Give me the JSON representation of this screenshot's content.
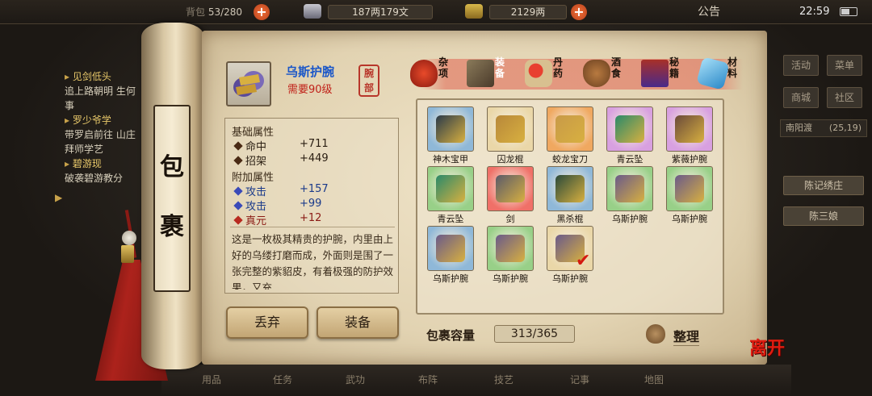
{
  "topbar": {
    "capacity": "53/280",
    "silver": "187两179文",
    "gold": "2129两",
    "notice": "公告",
    "clock": "22:59"
  },
  "quests": [
    {
      "title": "见剑低头",
      "desc": "追上路朝明 生何事"
    },
    {
      "title": "罗少爷学",
      "desc": "带罗启前往 山庄拜师学艺"
    },
    {
      "title": "碧游现",
      "desc": "破袭碧游教分"
    }
  ],
  "side_menu": {
    "buttons": [
      "活动",
      "菜单",
      "商城",
      "社区"
    ],
    "location": "南阳渡",
    "coords": "(25,19)",
    "npcs": [
      "陈记绣庄",
      "陈三娘"
    ]
  },
  "scroll_title": [
    "包",
    "裹"
  ],
  "item": {
    "name": "乌斯护腕",
    "level": "需要90级",
    "slot": "腕部",
    "base_header": "基础属性",
    "base_stats": [
      {
        "label": "命中",
        "value": "+711"
      },
      {
        "label": "招架",
        "value": "+449"
      }
    ],
    "extra_header": "附加属性",
    "extra_stats": [
      {
        "label": "攻击",
        "value": "+157"
      },
      {
        "label": "攻击",
        "value": "+99"
      },
      {
        "label": "真元",
        "value": "+12"
      }
    ],
    "description": "这是一枚极其精贵的护腕，内里由上好的乌缕打磨而成，外面则是围了一张完整的紫貂皮，有着极强的防护效果，又充"
  },
  "categories": [
    {
      "label": "杂项",
      "icon": "jar-icon"
    },
    {
      "label": "装备",
      "icon": "equipment-icon"
    },
    {
      "label": "丹药",
      "icon": "pill-icon"
    },
    {
      "label": "酒食",
      "icon": "wine-icon"
    },
    {
      "label": "秘籍",
      "icon": "book-icon"
    },
    {
      "label": "材料",
      "icon": "crystal-icon"
    }
  ],
  "grid_items": [
    {
      "name": "神木宝甲",
      "bg": "#8fb8d8",
      "gem": "#2a3a4a"
    },
    {
      "name": "囚龙棍",
      "bg": "#ead7a8",
      "gem": "#b8883a"
    },
    {
      "name": "蛟龙宝刀",
      "bg": "#f0a860",
      "gem": "#c89a48"
    },
    {
      "name": "青云坠",
      "bg": "#d8a0e0",
      "gem": "#2a8a6a"
    },
    {
      "name": "紫薇护腕",
      "bg": "#d8a0e0",
      "gem": "#6a4a3a"
    },
    {
      "name": "青云坠",
      "bg": "#98d088",
      "gem": "#2a8a6a"
    },
    {
      "name": "剑",
      "bg": "#f07068",
      "gem": "#5a5a6a"
    },
    {
      "name": "黑杀棍",
      "bg": "#8fb8d8",
      "gem": "#2a4a3a"
    },
    {
      "name": "乌斯护腕",
      "bg": "#98d088",
      "gem": "#6a5a8a"
    },
    {
      "name": "乌斯护腕",
      "bg": "#98d088",
      "gem": "#6a5a8a"
    },
    {
      "name": "乌斯护腕",
      "bg": "#8fb8d8",
      "gem": "#6a5a8a"
    },
    {
      "name": "乌斯护腕",
      "bg": "#98d088",
      "gem": "#6a5a8a"
    },
    {
      "name": "乌斯护腕",
      "bg": "#ead7a8",
      "gem": "#6a5a8a",
      "selected": true
    }
  ],
  "buttons": {
    "discard": "丢弃",
    "equip": "装备",
    "sort": "整理"
  },
  "capacity": {
    "label": "包裹容量",
    "value": "313/365"
  },
  "leave": "离开",
  "bottom_labels": [
    "用品",
    "任务",
    "武功",
    "布阵",
    "技艺",
    "记事",
    "地图"
  ]
}
